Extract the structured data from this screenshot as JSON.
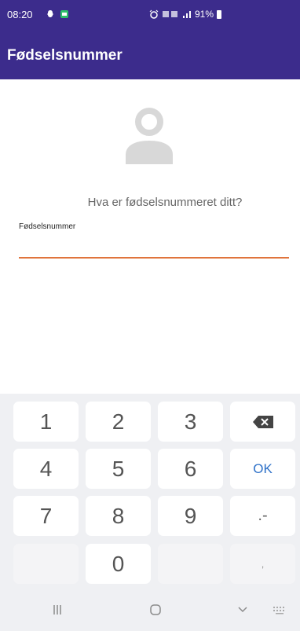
{
  "status_bar": {
    "time": "08:20",
    "battery_percent": "91%",
    "icons": [
      "snapchat-icon",
      "app-icon",
      "alarm-icon",
      "4g-icon",
      "signal-icon",
      "battery-icon"
    ]
  },
  "app_bar": {
    "title": "Fødselsnummer",
    "background": "#3c2c8c"
  },
  "form": {
    "prompt": "Hva er fødselsnummeret ditt?",
    "field_label": "Fødselsnummer",
    "field_value": "",
    "accent_color": "#e0743c"
  },
  "keyboard": {
    "keys": {
      "k1": "1",
      "k2": "2",
      "k3": "3",
      "k4": "4",
      "k5": "5",
      "k6": "6",
      "k7": "7",
      "k8": "8",
      "k9": "9",
      "k0": "0",
      "ok": "OK",
      "dot_dash": ".-",
      "comma": ","
    },
    "ok_color": "#2e71c8"
  },
  "nav_bar": {
    "icons": [
      "recent-apps-icon",
      "home-icon",
      "back-icon",
      "keyboard-switch-icon"
    ]
  }
}
